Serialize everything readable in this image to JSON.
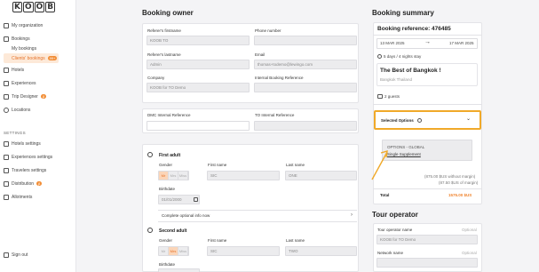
{
  "sidebar": {
    "logo": [
      "K",
      "O",
      "O",
      "B"
    ],
    "items": [
      {
        "label": "My organization"
      },
      {
        "label": "Bookings"
      },
      {
        "label": "My bookings"
      },
      {
        "label": "Clients' bookings",
        "badge": "99+"
      },
      {
        "label": "Hotels"
      },
      {
        "label": "Experiences"
      },
      {
        "label": "Trip Designer",
        "badge": "β"
      },
      {
        "label": "Locations"
      }
    ],
    "settings_label": "SETTINGS",
    "settings_items": [
      {
        "label": "Hotels settings"
      },
      {
        "label": "Experiences settings"
      },
      {
        "label": "Travelers settings"
      },
      {
        "label": "Distribution",
        "badge": "β"
      },
      {
        "label": "Allotments"
      }
    ],
    "sign_out": "Sign out"
  },
  "owner": {
    "title": "Booking owner",
    "referer_firstname_label": "Referer's firstname",
    "referer_firstname": "KOOB TO",
    "phone_label": "Phone number",
    "referer_lastname_label": "Referer's lastname",
    "referer_lastname": "Admin",
    "email_label": "Email",
    "email": "thomas+todemo@lewingo.com",
    "company_label": "Company",
    "company": "KOOB for TO Demo",
    "internal_ref_label": "Internal Booking Reference",
    "dmc_ref_label": "DMC Internal Reference",
    "to_ref_label": "TO Internal Reference"
  },
  "travelers": {
    "first_adult": "First adult",
    "second_adult": "Second adult",
    "gender_label": "Gender",
    "firstname_label": "First name",
    "lastname_label": "Last name",
    "birthdate_label": "Birthdate",
    "gender_options": [
      "Mr",
      "Mrs",
      "Miss"
    ],
    "adult1_firstname": "SIC",
    "adult1_lastname": "ONE",
    "adult1_birthdate": "01/01/2000",
    "adult2_firstname": "SIC",
    "adult2_lastname": "TWO",
    "optional_info": "Complete optional info now"
  },
  "summary": {
    "title": "Booking summary",
    "reference": "Booking reference: 476485",
    "start_date": "13 MAR 2025",
    "end_date": "17 MAR 2025",
    "duration": "5 days / 4 nights stay",
    "trip_name": "The Best of Bangkok !",
    "location": "Bangkok Thailand",
    "guests": "2 guests",
    "selected_options": "Selected Options",
    "options_global": "OPTIONS - GLOBAL",
    "single_supplement": "Single Supplement",
    "price_without_margin": "(875.00 $US without margin)",
    "margin": "(87.50 $US of margin)",
    "total_label": "Total",
    "total_value": "1575.00 $US"
  },
  "tour_operator": {
    "title": "Tour operator",
    "name_label": "Tour operator name",
    "optional": "Optional",
    "name_value": "KOOB for TO Demo",
    "network_label": "Network name"
  },
  "colors": {
    "accent": "#e6732a",
    "highlight": "#f0a929",
    "total": "#f0842e"
  }
}
